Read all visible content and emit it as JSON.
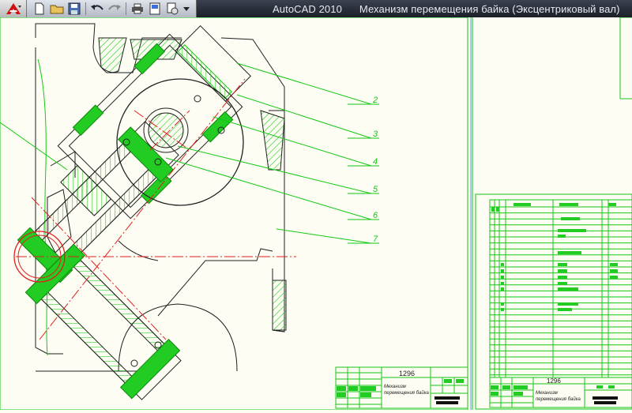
{
  "window": {
    "app_name": "AutoCAD 2010",
    "document_title": "Механизм перемещения байка (Эксцентриковый вал)"
  },
  "toolbar": {
    "buttons": [
      {
        "name": "new-icon"
      },
      {
        "name": "open-icon"
      },
      {
        "name": "save-icon"
      },
      {
        "name": "undo-icon"
      },
      {
        "name": "redo-icon"
      },
      {
        "name": "print-icon"
      },
      {
        "name": "properties-icon"
      },
      {
        "name": "publish-icon"
      },
      {
        "name": "customize-dropdown-icon"
      }
    ]
  },
  "drawing": {
    "callouts": [
      "2",
      "3",
      "4",
      "5",
      "6",
      "7"
    ],
    "main_title_block": {
      "drawing_number": "1296",
      "name_line1": "Механизм",
      "name_line2": "перемещения байка"
    },
    "spec_title_block": {
      "drawing_number": "1296",
      "name_line1": "Механизм",
      "name_line2": "перемещения байка"
    }
  },
  "colors": {
    "background": "#fdfdf3",
    "lines": "#14c814",
    "hatch": "#22cc22",
    "centerline": "#e02020",
    "outline": "#202020"
  }
}
